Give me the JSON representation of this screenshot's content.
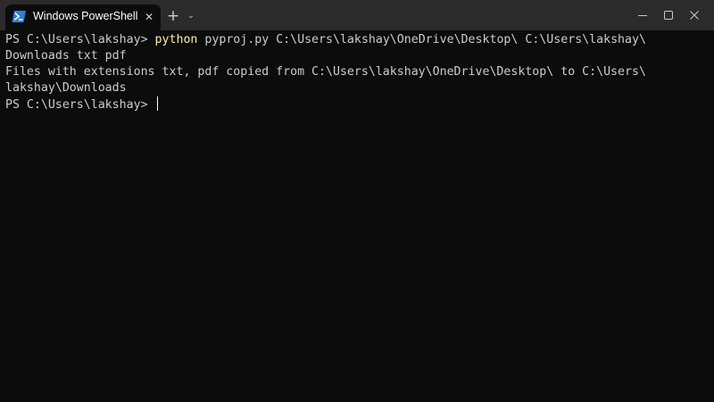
{
  "window": {
    "tab_title": "Windows PowerShell",
    "tab_icon": "powershell-icon",
    "new_tab_label": "+",
    "dropdown_label": "⌄",
    "close_tab_label": "✕"
  },
  "colors": {
    "background": "#0c0c0c",
    "titlebar": "#2b2b2b",
    "text": "#cccccc",
    "command": "#f9f1a5",
    "powershell_blue": "#2d7fd3"
  },
  "terminal": {
    "line1": {
      "prompt": "PS C:\\Users\\lakshay> ",
      "command": "python",
      "args": " pyproj.py C:\\Users\\lakshay\\OneDrive\\Desktop\\ C:\\Users\\lakshay\\"
    },
    "line2": "Downloads txt pdf",
    "line3": "Files with extensions txt, pdf copied from C:\\Users\\lakshay\\OneDrive\\Desktop\\ to C:\\Users\\",
    "line4": "lakshay\\Downloads",
    "line5": {
      "prompt": "PS C:\\Users\\lakshay> "
    }
  }
}
